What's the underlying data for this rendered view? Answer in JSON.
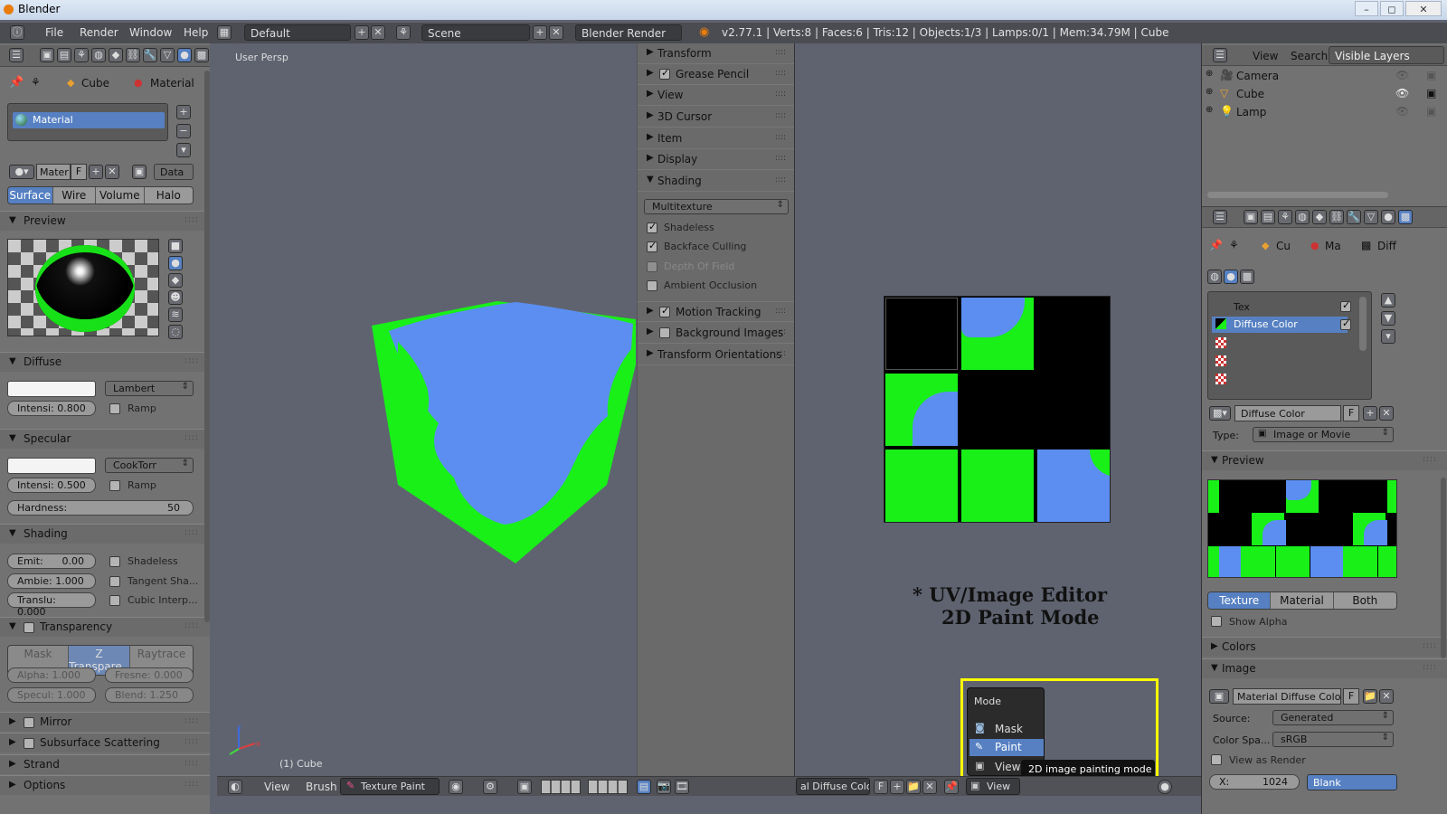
{
  "window": {
    "title": "Blender",
    "minimize": "–",
    "maximize": "◻",
    "close": "✕"
  },
  "infobar": {
    "menus": [
      "File",
      "Render",
      "Window",
      "Help"
    ],
    "screen_layout": "Default",
    "scene": "Scene",
    "render_engine": "Blender Render",
    "stats": "v2.77.1 | Verts:8 | Faces:6 | Tris:12 | Objects:1/3 | Lamps:0/1 | Mem:34.79M | Cube"
  },
  "left_panel": {
    "breadcrumb": {
      "object": "Cube",
      "material": "Material"
    },
    "material_slot": "Material",
    "material_name": "Mater",
    "fake_user": "F",
    "data_link": "Data",
    "tabs": [
      "Surface",
      "Wire",
      "Volume",
      "Halo"
    ],
    "sections": {
      "preview": "Preview",
      "diffuse": "Diffuse",
      "specular": "Specular",
      "shading": "Shading",
      "transparency": "Transparency",
      "mirror": "Mirror",
      "sss": "Subsurface Scattering",
      "strand": "Strand",
      "options": "Options"
    },
    "diffuse": {
      "shader": "Lambert",
      "intensity": "Intensi: 0.800",
      "ramp": "Ramp"
    },
    "specular": {
      "shader": "CookTorr",
      "intensity": "Intensi: 0.500",
      "ramp": "Ramp",
      "hardness_label": "Hardness:",
      "hardness": "50"
    },
    "shading": {
      "emit": "Emit:",
      "emit_val": "0.00",
      "ambient": "Ambie: 1.000",
      "translucency": "Translu: 0.000",
      "shadeless": "Shadeless",
      "tangent": "Tangent Sha...",
      "cubic": "Cubic Interp..."
    },
    "transparency": {
      "modes": [
        "Mask",
        "Z Transpare...",
        "Raytrace"
      ],
      "alpha": "Alpha: 1.000",
      "fresnel": "Fresne: 0.000",
      "specular": "Specul: 1.000",
      "blend": "Blend: 1.250"
    }
  },
  "viewport": {
    "label": "User Persp",
    "object_label": "(1) Cube",
    "axis_z": "z",
    "axis_x": "x"
  },
  "n_panel": {
    "items": [
      {
        "label": "Transform",
        "expanded": false
      },
      {
        "label": "Grease Pencil",
        "expanded": false,
        "checkbox": true
      },
      {
        "label": "View",
        "expanded": false
      },
      {
        "label": "3D Cursor",
        "expanded": false
      },
      {
        "label": "Item",
        "expanded": false
      },
      {
        "label": "Display",
        "expanded": false
      },
      {
        "label": "Shading",
        "expanded": true
      }
    ],
    "shading_mode": "Multitexture",
    "shading_options": [
      {
        "label": "Shadeless",
        "checked": true,
        "enabled": true
      },
      {
        "label": "Backface Culling",
        "checked": true,
        "enabled": true
      },
      {
        "label": "Depth Of Field",
        "checked": false,
        "enabled": false
      },
      {
        "label": "Ambient Occlusion",
        "checked": false,
        "enabled": true
      }
    ],
    "after": [
      {
        "label": "Motion Tracking",
        "checkbox": true
      },
      {
        "label": "Background Images",
        "checkbox": false
      },
      {
        "label": "Transform Orientations"
      }
    ]
  },
  "uv_editor": {
    "annotation_line1": "* UV/Image Editor",
    "annotation_line2": "2D Paint Mode",
    "mode_menu": {
      "title": "Mode",
      "items": [
        "Mask",
        "Paint",
        "View"
      ],
      "selected": "Paint"
    },
    "tooltip": "2D image painting mode",
    "bottom_image": "al Diffuse Color",
    "bottom_f": "F",
    "bottom_view": "View"
  },
  "viewport_bottom": {
    "menus": [
      "View",
      "Brush"
    ],
    "mode": "Texture Paint"
  },
  "outliner": {
    "tabs": [
      "View",
      "Search",
      "Visible Layers"
    ],
    "items": [
      "Camera",
      "Cube",
      "Lamp"
    ]
  },
  "properties_right": {
    "breadcrumb": [
      "Cu",
      "Ma",
      "Diff"
    ],
    "texture_slots": [
      "Tex",
      "Diffuse Color"
    ],
    "texture_name": "Diffuse Color",
    "fake_user": "F",
    "type_label": "Type:",
    "type_value": "Image or Movie",
    "preview_label": "Preview",
    "preview_tabs": [
      "Texture",
      "Material",
      "Both"
    ],
    "show_alpha": "Show Alpha",
    "colors_label": "Colors",
    "image_label": "Image",
    "image_name": "Material Diffuse Color",
    "source_label": "Source:",
    "source_value": "Generated",
    "colorspace_label": "Color Spa...",
    "colorspace_value": "sRGB",
    "view_as_render": "View as Render",
    "x_label": "X:",
    "x_value": "1024",
    "blank": "Blank"
  },
  "colors": {
    "blue": "#5b8ef0",
    "green": "#18f018",
    "selection": "#5680c2",
    "highlight": "#ffff00"
  }
}
